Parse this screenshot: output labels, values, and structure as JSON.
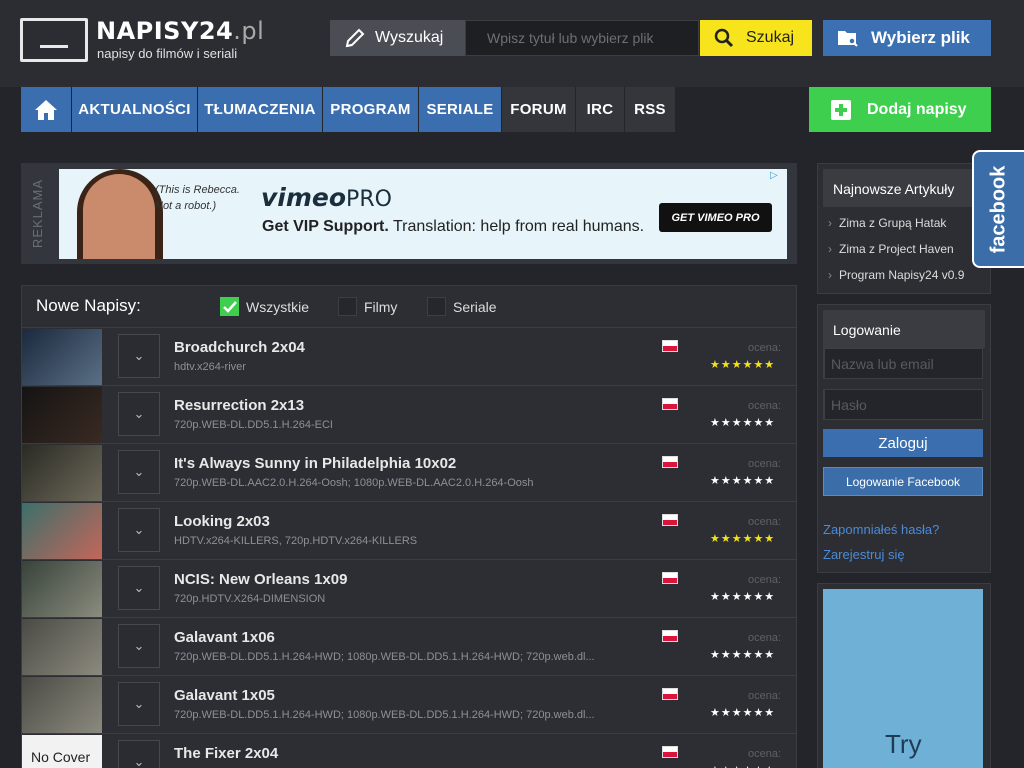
{
  "logo": {
    "title": "NAPISY24",
    "domain": ".pl",
    "subtitle": "napisy do filmów i seriali"
  },
  "search": {
    "label": "Wyszukaj",
    "placeholder": "Wpisz tytuł lub wybierz plik",
    "button": "Szukaj",
    "choose_file": "Wybierz plik"
  },
  "nav": {
    "items": [
      "AKTUALNOŚCI",
      "TŁUMACZENIA",
      "PROGRAM",
      "SERIALE",
      "FORUM",
      "IRC",
      "RSS"
    ],
    "add": "Dodaj napisy"
  },
  "ad": {
    "label": "REKLAMA",
    "quote_line1": "(This is Rebecca.",
    "quote_line2": "Not a robot.)",
    "brand": "vimeo",
    "brand_suffix": "PRO",
    "headline_bold": "Get VIP Support.",
    "headline_rest": " Translation: help from real humans.",
    "cta": "GET VIMEO PRO"
  },
  "list": {
    "title": "Nowe Napisy:",
    "filters": [
      {
        "label": "Wszystkie",
        "checked": true
      },
      {
        "label": "Filmy",
        "checked": false
      },
      {
        "label": "Seriale",
        "checked": false
      }
    ],
    "rating_label": "ocena:",
    "items": [
      {
        "title": "Broadchurch 2x04",
        "release": "hdtv.x264-river",
        "stars": 6,
        "rated": true
      },
      {
        "title": "Resurrection 2x13",
        "release": "720p.WEB-DL.DD5.1.H.264-ECI",
        "stars": 6,
        "rated": false
      },
      {
        "title": "It's Always Sunny in Philadelphia 10x02",
        "release": "720p.WEB-DL.AAC2.0.H.264-Oosh; 1080p.WEB-DL.AAC2.0.H.264-Oosh",
        "stars": 6,
        "rated": false
      },
      {
        "title": "Looking 2x03",
        "release": "HDTV.x264-KILLERS, 720p.HDTV.x264-KILLERS",
        "stars": 6,
        "rated": true
      },
      {
        "title": "NCIS: New Orleans 1x09",
        "release": "720p.HDTV.X264-DIMENSION",
        "stars": 6,
        "rated": false
      },
      {
        "title": "Galavant 1x06",
        "release": "720p.WEB-DL.DD5.1.H.264-HWD; 1080p.WEB-DL.DD5.1.H.264-HWD; 720p.web.dl...",
        "stars": 6,
        "rated": false
      },
      {
        "title": "Galavant 1x05",
        "release": "720p.WEB-DL.DD5.1.H.264-HWD; 1080p.WEB-DL.DD5.1.H.264-HWD; 720p.web.dl...",
        "stars": 6,
        "rated": false
      },
      {
        "title": "The Fixer 2x04",
        "release": "",
        "stars": 6,
        "rated": false,
        "no_cover": "No Cover"
      }
    ]
  },
  "sidebar": {
    "articles_title": "Najnowsze Artykuły",
    "articles": [
      "Zima z Grupą Hatak",
      "Zima z Project Haven",
      "Program Napisy24 v0.9"
    ],
    "login_title": "Logowanie",
    "login_placeholder": "Nazwa lub email",
    "password_placeholder": "Hasło",
    "login_button": "Zaloguj",
    "facebook_login": "Logowanie Facebook",
    "forgot": "Zapomniałeś hasła?",
    "register": "Zarejestruj się",
    "ad_text": "Try"
  },
  "facebook_tab": "facebook"
}
